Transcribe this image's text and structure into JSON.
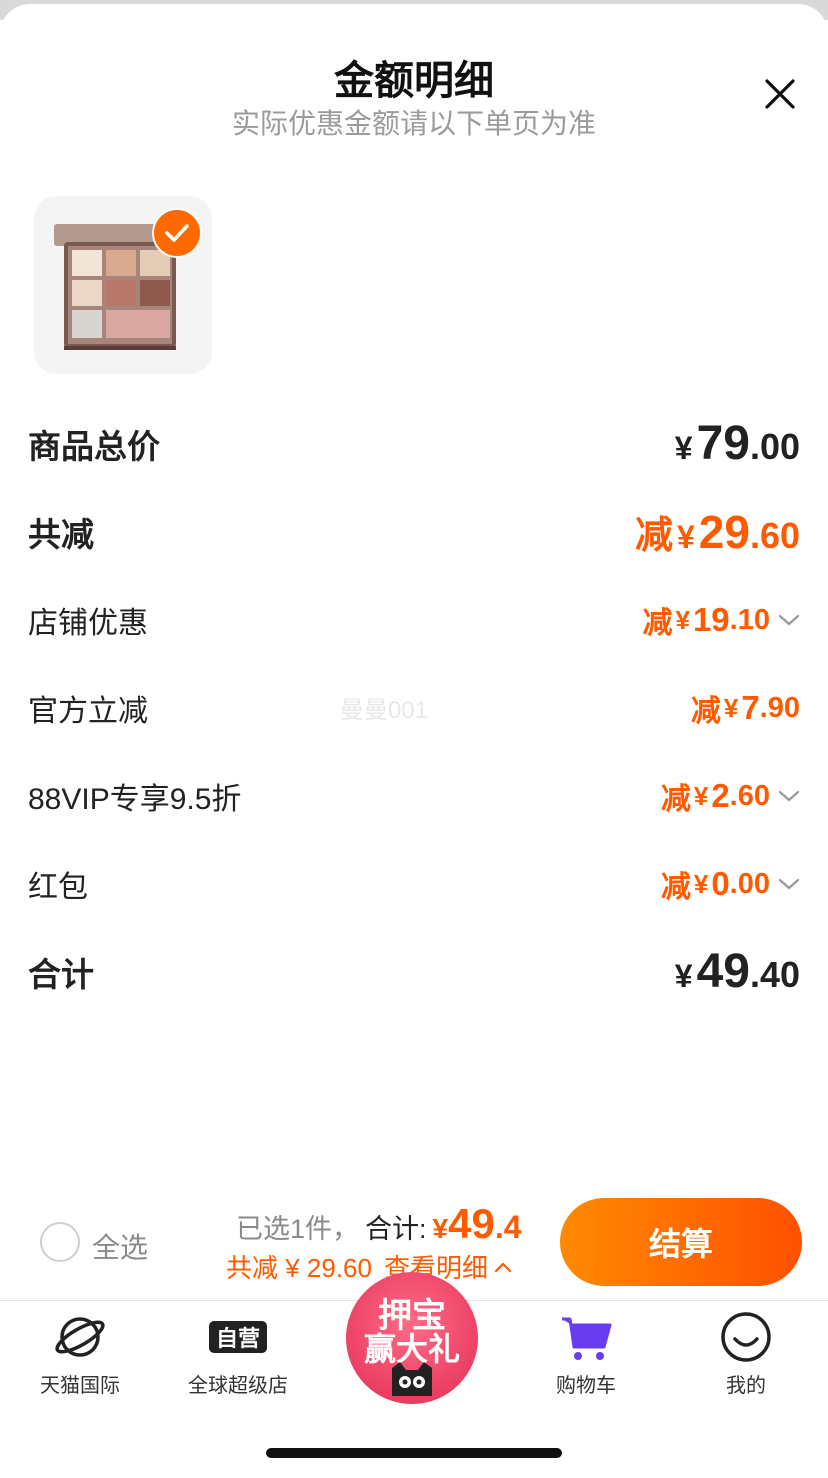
{
  "header": {
    "title": "金额明细",
    "subtitle": "实际优惠金额请以下单页为准"
  },
  "product": {
    "image_alt": "眼影盘",
    "selected": true
  },
  "rows": {
    "total_price": {
      "label": "商品总价",
      "currency": "¥",
      "int": "79",
      "dec": ".00"
    },
    "total_discount": {
      "label": "共减",
      "prefix": "减",
      "currency": "¥",
      "int": "29",
      "dec": ".60"
    },
    "store_discount": {
      "label": "店铺优惠",
      "prefix": "减",
      "currency": "¥",
      "int": "19",
      "dec": ".10"
    },
    "official_discount": {
      "label": "官方立减",
      "prefix": "减",
      "currency": "¥",
      "int": "7",
      "dec": ".90"
    },
    "vip_discount": {
      "label": "88VIP专享9.5折",
      "prefix": "减",
      "currency": "¥",
      "int": "2",
      "dec": ".60"
    },
    "red_packet": {
      "label": "红包",
      "prefix": "减",
      "currency": "¥",
      "int": "0",
      "dec": ".00"
    },
    "grand_total": {
      "label": "合计",
      "currency": "¥",
      "int": "49",
      "dec": ".40"
    }
  },
  "watermark": "曼曼001",
  "bottom_bar": {
    "select_all": "全选",
    "selected_count": "已选1件，",
    "total_label": "合计:",
    "currency": "¥",
    "total_int": "49",
    "total_dec": ".4",
    "discount_text": "共减 ¥ 29.60",
    "detail_link": "查看明细",
    "checkout_label": "结算"
  },
  "tabs": [
    {
      "label": "天猫国际",
      "icon": "planet-icon"
    },
    {
      "label": "全球超级店",
      "icon": "self-operated-icon"
    },
    {
      "label": "押宝赢大礼",
      "icon": "promo-badge"
    },
    {
      "label": "购物车",
      "icon": "cart-icon"
    },
    {
      "label": "我的",
      "icon": "smile-icon"
    }
  ],
  "promo": {
    "line1": "押宝",
    "line2": "赢大礼"
  },
  "colors": {
    "accent": "#ff5a00",
    "checkout_start": "#ff8a00",
    "checkout_end": "#ff5000",
    "cart_active": "#6a3cf0",
    "promo": "#e32d55"
  }
}
